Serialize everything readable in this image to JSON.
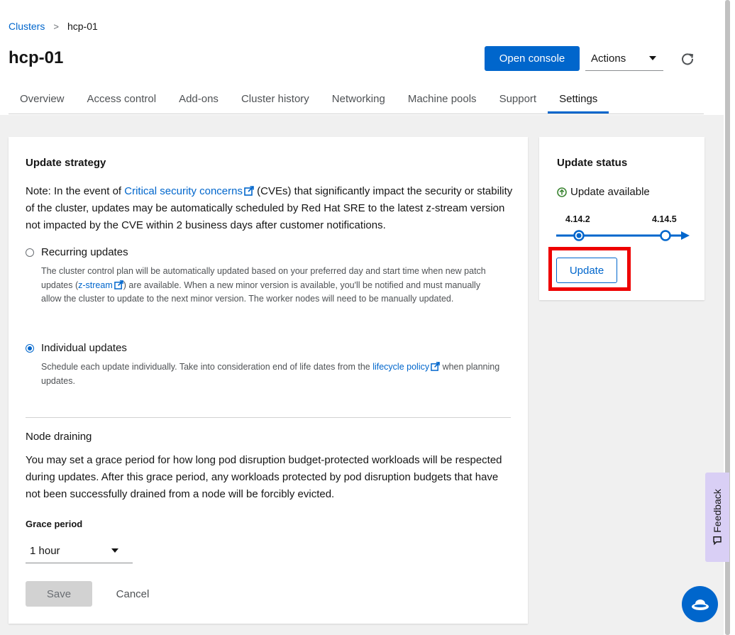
{
  "breadcrumb": {
    "root": "Clusters",
    "sep": ">",
    "current": "hcp-01"
  },
  "page": {
    "title": "hcp-01"
  },
  "header": {
    "open_console": "Open console",
    "actions": "Actions"
  },
  "tabs": [
    "Overview",
    "Access control",
    "Add-ons",
    "Cluster history",
    "Networking",
    "Machine pools",
    "Support",
    "Settings"
  ],
  "active_tab": "Settings",
  "update_strategy": {
    "title": "Update strategy",
    "note_prefix": "Note: In the event of ",
    "note_link": "Critical security concerns",
    "note_suffix": " (CVEs) that significantly impact the security or stability of the cluster, updates may be automatically scheduled by Red Hat SRE to the latest z-stream version not impacted by the CVE within 2 business days after customer notifications.",
    "recurring": {
      "label": "Recurring updates",
      "help_1": "The cluster control plan will be automatically updated based on your preferred day and start time when new patch updates (",
      "help_link": "z-stream",
      "help_2": ") are available. When a new minor version is available, you'll be notified and must manually allow the cluster to update to the next minor version. The worker nodes will need to be manually updated."
    },
    "individual": {
      "label": "Individual updates",
      "help_1": "Schedule each update individually. Take into consideration end of life dates from the ",
      "help_link": "lifecycle policy",
      "help_2": " when planning updates."
    }
  },
  "node_draining": {
    "title": "Node draining",
    "description": "You may set a grace period for how long pod disruption budget-protected workloads will be respected during updates. After this grace period, any workloads protected by pod disruption budgets that have not been successfully drained from a node will be forcibly evicted.",
    "grace_label": "Grace period",
    "grace_value": "1 hour"
  },
  "form": {
    "save": "Save",
    "cancel": "Cancel"
  },
  "update_status": {
    "title": "Update status",
    "status": "Update available",
    "current_version": "4.14.2",
    "target_version": "4.14.5",
    "update_button": "Update"
  },
  "feedback": {
    "label": "Feedback"
  },
  "colors": {
    "brand": "#0066cc",
    "highlight": "#ee0000",
    "feedback_bg": "#d9cff5",
    "success": "#3e8635"
  }
}
